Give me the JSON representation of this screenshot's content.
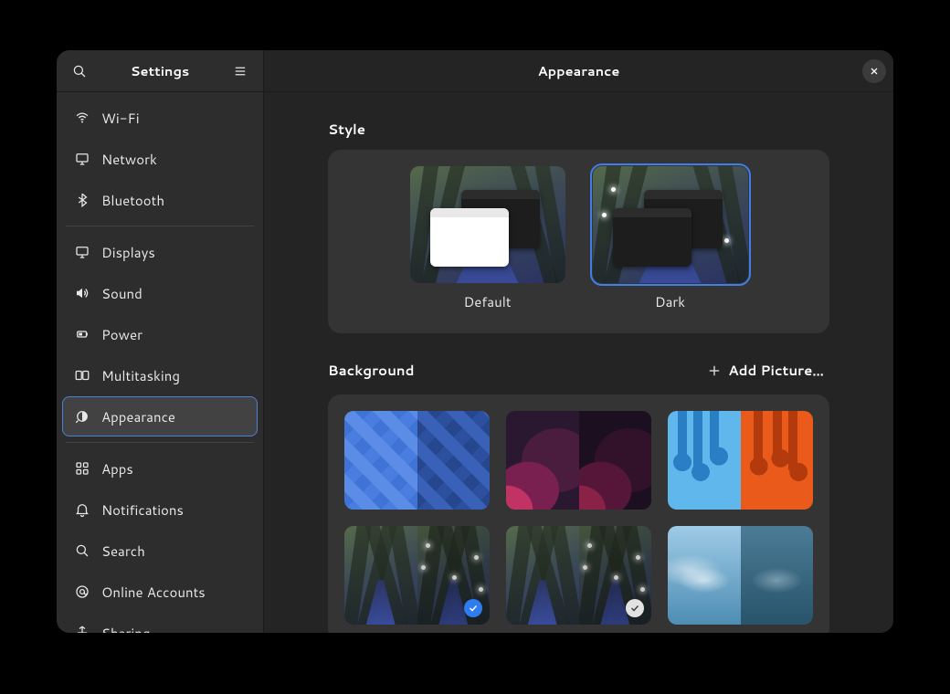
{
  "sidebar": {
    "title": "Settings",
    "groups": [
      [
        {
          "id": "wifi",
          "label": "Wi-Fi",
          "icon": "wifi"
        },
        {
          "id": "network",
          "label": "Network",
          "icon": "display"
        },
        {
          "id": "bluetooth",
          "label": "Bluetooth",
          "icon": "bluetooth"
        }
      ],
      [
        {
          "id": "displays",
          "label": "Displays",
          "icon": "display"
        },
        {
          "id": "sound",
          "label": "Sound",
          "icon": "speaker"
        },
        {
          "id": "power",
          "label": "Power",
          "icon": "power"
        },
        {
          "id": "multitasking",
          "label": "Multitasking",
          "icon": "multitask"
        },
        {
          "id": "appearance",
          "label": "Appearance",
          "icon": "appearance",
          "active": true
        }
      ],
      [
        {
          "id": "apps",
          "label": "Apps",
          "icon": "apps"
        },
        {
          "id": "notifications",
          "label": "Notifications",
          "icon": "bell"
        },
        {
          "id": "search",
          "label": "Search",
          "icon": "search"
        },
        {
          "id": "online",
          "label": "Online Accounts",
          "icon": "at"
        },
        {
          "id": "sharing",
          "label": "Sharing",
          "icon": "share"
        }
      ]
    ]
  },
  "main": {
    "title": "Appearance",
    "style": {
      "heading": "Style",
      "options": [
        {
          "id": "default",
          "label": "Default",
          "selected": false,
          "variant": "light"
        },
        {
          "id": "dark",
          "label": "Dark",
          "selected": true,
          "variant": "dark"
        }
      ]
    },
    "background": {
      "heading": "Background",
      "add_label": "Add Picture…",
      "items": [
        {
          "id": "geometric",
          "light": "bg-geo-light",
          "dark": "bg-geo-dark"
        },
        {
          "id": "waves",
          "light": "bg-wave-light",
          "dark": "bg-wave-dark"
        },
        {
          "id": "drips",
          "light": "bg-drip-light",
          "dark": "bg-drip-dark"
        },
        {
          "id": "forest-a",
          "light": "bg-forest",
          "dark": "bg-forest dim",
          "selected": "blue"
        },
        {
          "id": "forest-b",
          "light": "bg-forest",
          "dark": "bg-forest dim",
          "selected": "grey"
        },
        {
          "id": "sky",
          "light": "bg-sky-light",
          "dark": "bg-sky-dark"
        }
      ]
    }
  }
}
